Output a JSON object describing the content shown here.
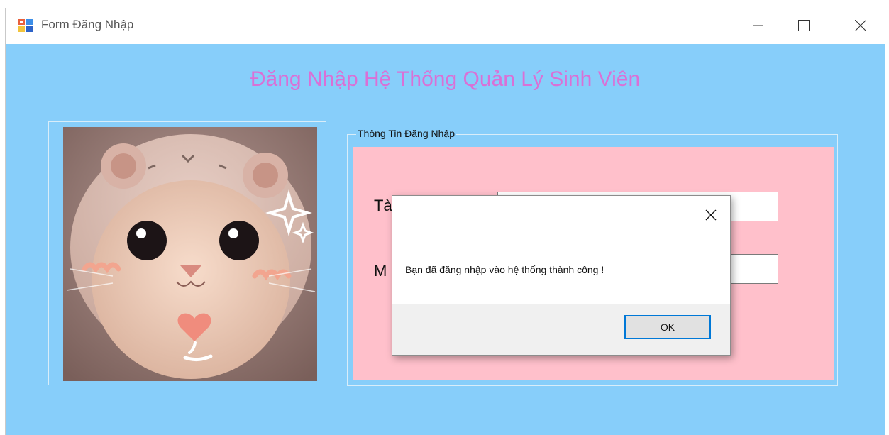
{
  "window": {
    "title": "Form Đăng Nhập",
    "icon": "form-app-icon"
  },
  "main": {
    "heading": "Đăng Nhập Hệ Thống Quản Lý Sinh Viên",
    "image": "cat-photo"
  },
  "login_group": {
    "legend": "Thông Tin Đăng Nhập",
    "username_label": "Tà",
    "password_label": "M"
  },
  "dialog": {
    "message": "Bạn đã đăng nhập vào hệ thống thành công !",
    "ok_label": "OK"
  },
  "colors": {
    "background": "#87CEFA",
    "heading": "#DA70D6",
    "panel": "#FFC0CB",
    "accent": "#0078D7"
  }
}
